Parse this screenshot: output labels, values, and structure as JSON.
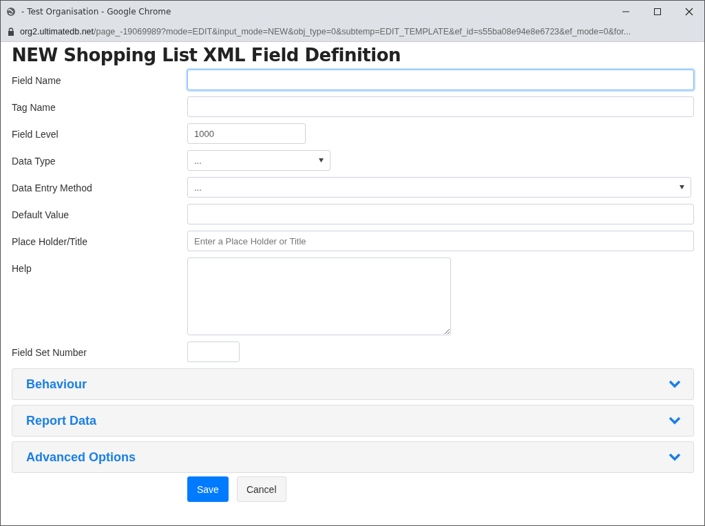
{
  "window": {
    "title": "- Test Organisation - Google Chrome",
    "url_host": "org2.ultimatedb.net",
    "url_path": "/page_-19069989?mode=EDIT&input_mode=NEW&obj_type=0&subtemp=EDIT_TEMPLATE&ef_id=s55ba08e94e8e6723&ef_mode=0&for..."
  },
  "heading": "NEW Shopping List XML Field Definition",
  "fields": [
    {
      "label": "Field Name",
      "kind": "text",
      "focused": true
    },
    {
      "label": "Tag Name",
      "kind": "text",
      "focused": false
    },
    {
      "label": "Field Level",
      "kind": "text",
      "value": "1000",
      "focused": false
    },
    {
      "label": "Data Type",
      "kind": "select",
      "value": "...",
      "focused": false
    },
    {
      "label": "Data Entry Method",
      "kind": "select",
      "value": "...",
      "focused": false
    },
    {
      "label": "Default Value",
      "kind": "text",
      "focused": false
    },
    {
      "label": "Place Holder/Title",
      "kind": "text",
      "placeholder": "Enter a Place Holder or Title",
      "focused": false
    },
    {
      "label": "Help",
      "kind": "textarea",
      "focused": false
    },
    {
      "label": "Field Set Number",
      "kind": "text",
      "focused": false
    }
  ],
  "sections": [
    {
      "title": "Behaviour",
      "expanded": false
    },
    {
      "title": "Report Data",
      "expanded": false
    },
    {
      "title": "Advanced Options",
      "expanded": false
    }
  ],
  "buttons": [
    {
      "label": "Save",
      "kind": "primary"
    },
    {
      "label": "Cancel",
      "kind": "secondary"
    }
  ]
}
